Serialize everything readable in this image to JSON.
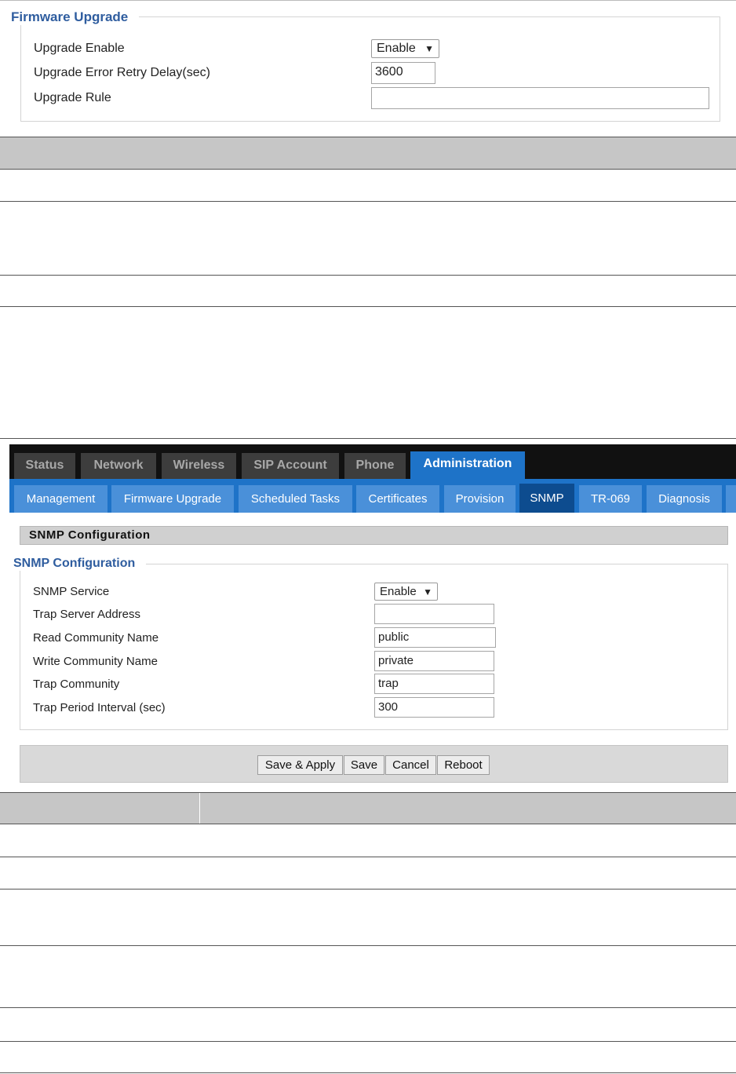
{
  "firmware": {
    "legend": "Firmware Upgrade",
    "fields": [
      {
        "label": "Upgrade Enable",
        "value": "Enable"
      },
      {
        "label": "Upgrade Error Retry Delay(sec)",
        "value": "3600"
      },
      {
        "label": "Upgrade Rule",
        "value": ""
      }
    ],
    "arrow": "▼"
  },
  "tabs": [
    "Status",
    "Network",
    "Wireless",
    "SIP Account",
    "Phone",
    "Administration"
  ],
  "subtabs": [
    "Management",
    "Firmware Upgrade",
    "Scheduled Tasks",
    "Certificates",
    "Provision",
    "SNMP",
    "TR-069",
    "Diagnosis"
  ],
  "snmp": {
    "title": "SNMP Configuration",
    "legend": "SNMP Configuration",
    "fields": [
      {
        "label": "SNMP Service",
        "value": "Enable"
      },
      {
        "label": "Trap Server Address",
        "value": ""
      },
      {
        "label": "Read Community Name",
        "value": "public"
      },
      {
        "label": "Write Community Name",
        "value": "private"
      },
      {
        "label": "Trap Community",
        "value": "trap"
      },
      {
        "label": "Trap Period Interval (sec)",
        "value": "300"
      }
    ]
  },
  "buttons": [
    "Save & Apply",
    "Save",
    "Cancel",
    "Reboot"
  ]
}
